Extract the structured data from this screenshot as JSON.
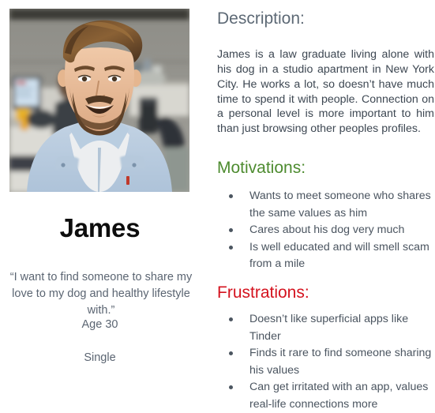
{
  "persona": {
    "photo_alt": "persona-portrait-photo",
    "name": "James",
    "quote": "“I want to find someone to share my love to my dog and healthy lifestyle with.”",
    "age": "Age 30",
    "relationship_status": "Single"
  },
  "sections": {
    "description": {
      "heading": "Description:",
      "body": "James is a law graduate living alone with his dog in a studio apartment in New York City. He works a lot, so doesn’t have much time to spend it with people. Connection on a personal level is more important to him than just browsing other peoples profiles.",
      "color": "#5d6975"
    },
    "motivations": {
      "heading": "Motivations:",
      "color": "#4d8b2f",
      "items": [
        "Wants to meet someone who shares the same values as him",
        "Cares about his dog very much",
        "Is well educated and will smell scam from a mile"
      ]
    },
    "frustrations": {
      "heading": "Frustrations:",
      "color": "#d4121e",
      "items": [
        "Doesn’t like superficial apps like Tinder",
        "Finds it rare to find someone sharing his values",
        "Can get irritated with an app, values real-life connections more"
      ]
    }
  },
  "colors": {
    "background": "#ffffff",
    "body_text": "#3d4752",
    "muted_text": "#5b6572",
    "name_text": "#0d0d0d",
    "bullet": "#4b5560"
  }
}
